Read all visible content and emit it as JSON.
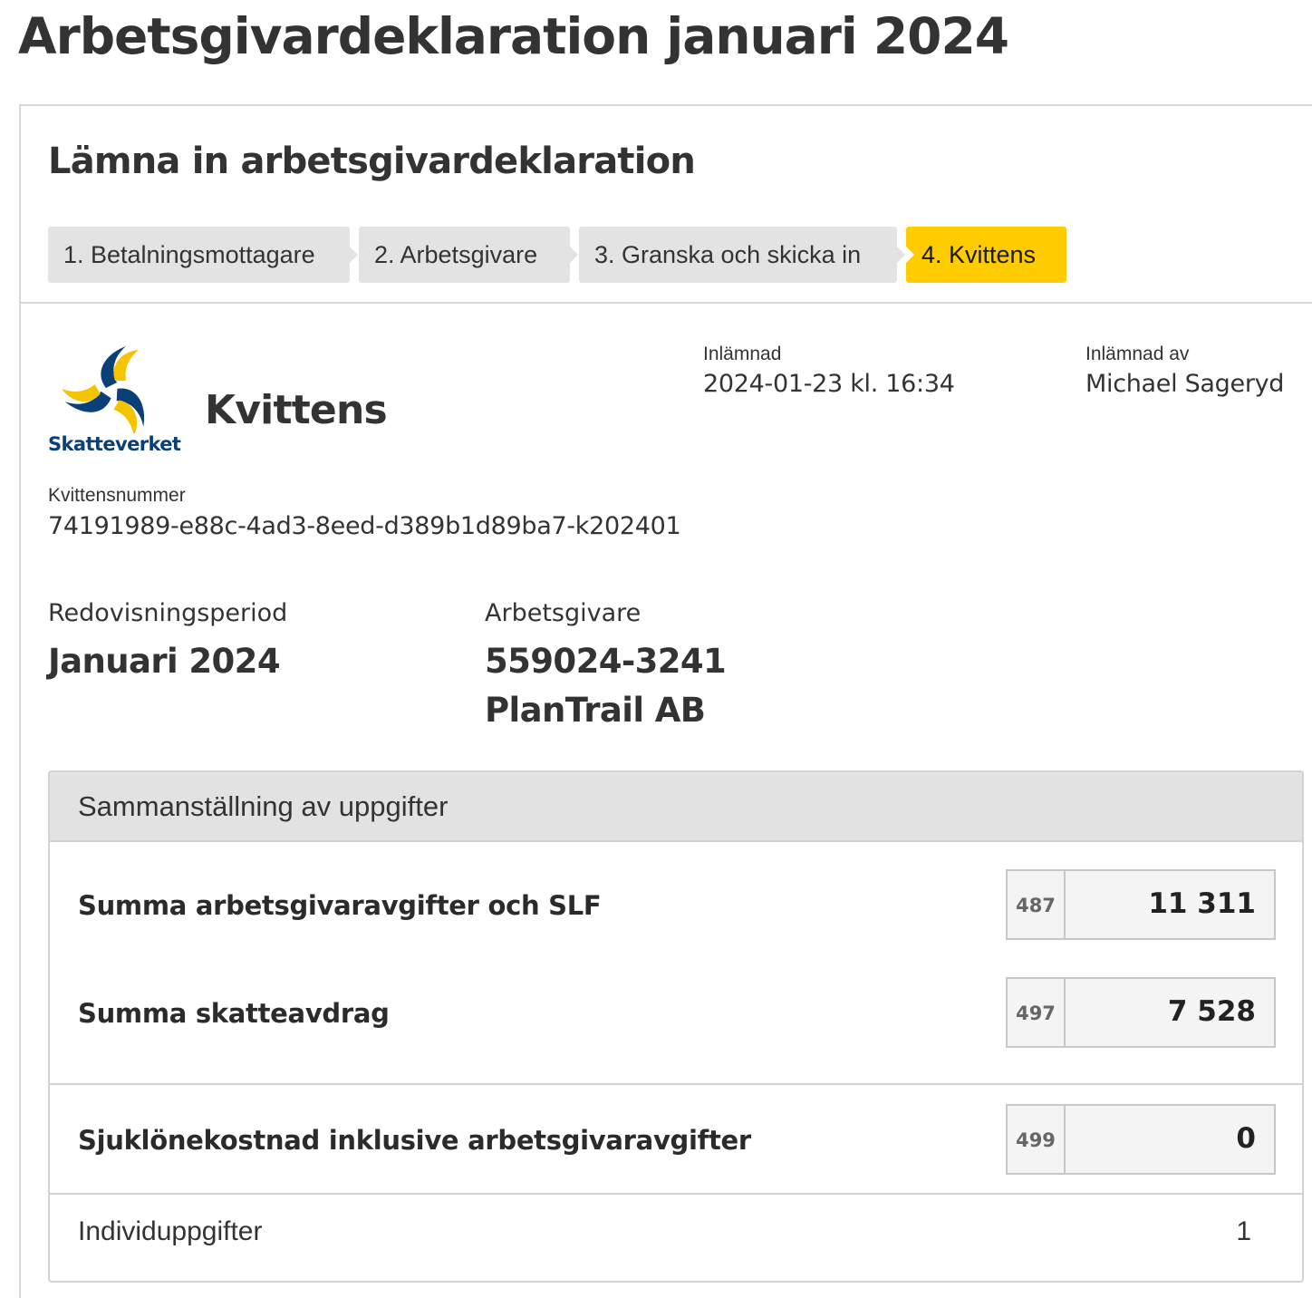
{
  "page": {
    "title": "Arbetsgivardeklaration januari 2024"
  },
  "card": {
    "title": "Lämna in arbetsgivardeklaration"
  },
  "steps": [
    {
      "label": "1. Betalningsmottagare",
      "active": false
    },
    {
      "label": "2. Arbetsgivare",
      "active": false
    },
    {
      "label": "3. Granska och skicka in",
      "active": false
    },
    {
      "label": "4. Kvittens",
      "active": true
    }
  ],
  "receipt": {
    "logo_text": "Skatteverket",
    "heading": "Kvittens",
    "submitted_label": "Inlämnad",
    "submitted_value": "2024-01-23 kl. 16:34",
    "submitted_by_label": "Inlämnad av",
    "submitted_by_value": "Michael Sageryd",
    "number_label": "Kvittensnummer",
    "number_value": "74191989-e88c-4ad3-8eed-d389b1d89ba7-k202401"
  },
  "info": {
    "period_label": "Redovisningsperiod",
    "period_value": "Januari 2024",
    "employer_label": "Arbetsgivare",
    "employer_orgnr": "559024-3241",
    "employer_name": "PlanTrail AB"
  },
  "summary": {
    "header": "Sammanställning av uppgifter",
    "rows": [
      {
        "label": "Summa arbetsgivaravgifter och SLF",
        "code": "487",
        "value": "11 311"
      },
      {
        "label": "Summa skatteavdrag",
        "code": "497",
        "value": "7 528"
      },
      {
        "label": "Sjuklönekostnad inklusive arbetsgivaravgifter",
        "code": "499",
        "value": "0"
      }
    ],
    "individual_label": "Individuppgifter",
    "individual_value": "1"
  },
  "colors": {
    "active_step": "#ffcc00",
    "inactive_step": "#e3e3e3",
    "logo_blue": "#0b3f78",
    "logo_yellow": "#f5c400"
  },
  "icons": {
    "logo": "skatteverket-logo"
  }
}
